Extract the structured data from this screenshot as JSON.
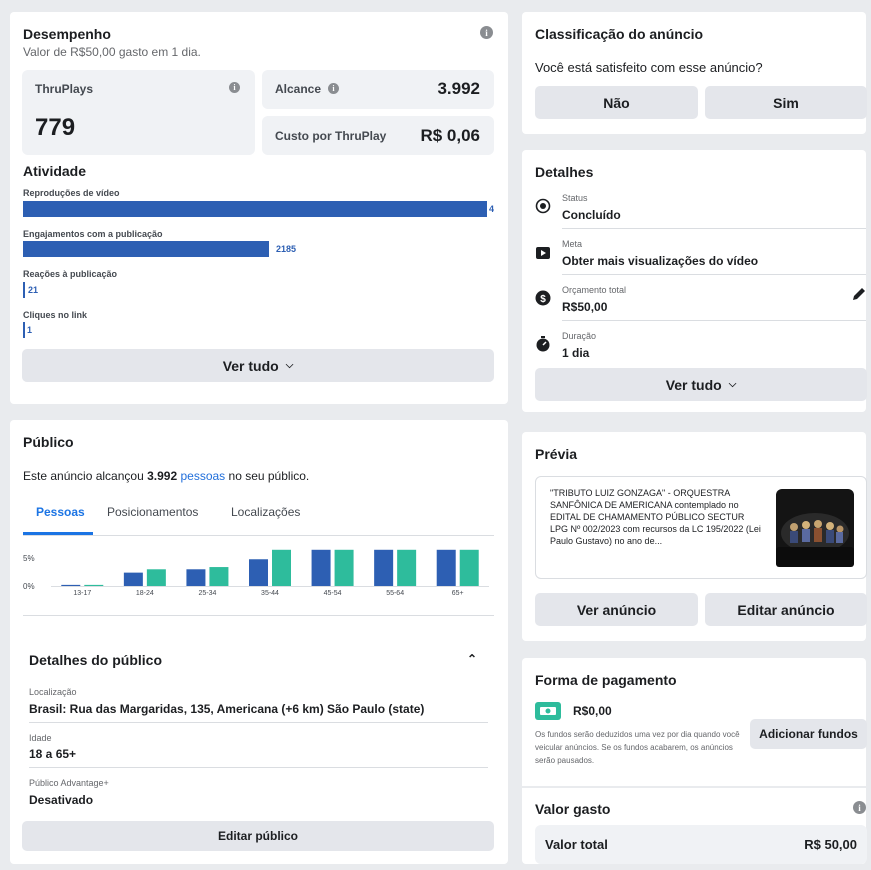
{
  "performance": {
    "title": "Desempenho",
    "subtitle": "Valor de R$50,00 gasto em 1 dia.",
    "thruplays_label": "ThruPlays",
    "thruplays_value": "779",
    "reach_label": "Alcance",
    "reach_value": "3.992",
    "cost_label": "Custo por ThruPlay",
    "cost_value": "R$ 0,06"
  },
  "activity": {
    "title": "Atividade",
    "items": [
      {
        "label": "Reproduções de vídeo",
        "value": "4",
        "fraction": 1.0
      },
      {
        "label": "Engajamentos com a publicação",
        "value": "2185",
        "fraction": 0.53
      },
      {
        "label": "Reações à publicação",
        "value": "21",
        "fraction": 0.005
      },
      {
        "label": "Cliques no link",
        "value": "1",
        "fraction": 0.001
      }
    ],
    "see_all": "Ver tudo"
  },
  "audience": {
    "title": "Público",
    "reach_prefix": "Este anúncio alcançou",
    "reach_number": "3.992",
    "reach_link": "pessoas",
    "reach_suffix": "no seu público.",
    "tabs": [
      "Pessoas",
      "Posicionamentos",
      "Localizações"
    ],
    "details_title": "Detalhes do público",
    "location_label": "Localização",
    "location_value": "Brasil: Rua das Margaridas, 135, Americana (+6 km) São Paulo (state)",
    "age_label": "Idade",
    "age_value": "18 a 65+",
    "advantage_label": "Público Advantage+",
    "advantage_value": "Desativado",
    "edit_button": "Editar público"
  },
  "chart_data": {
    "type": "bar",
    "categories": [
      "13-17",
      "18-24",
      "25-34",
      "35-44",
      "45-54",
      "55-64",
      "65+"
    ],
    "yticks": [
      "5%",
      "0%"
    ],
    "ylim": [
      0,
      7
    ],
    "series": [
      {
        "color": "#2d5fb3",
        "values": [
          0.2,
          2.4,
          3.0,
          4.8,
          6.5,
          6.5,
          6.5
        ]
      },
      {
        "color": "#2ebc9c",
        "values": [
          0.2,
          3.0,
          3.4,
          6.5,
          6.5,
          6.5,
          6.5
        ]
      }
    ]
  },
  "rating": {
    "title": "Classificação do anúncio",
    "question": "Você está satisfeito com esse anúncio?",
    "no_label": "Não",
    "yes_label": "Sim"
  },
  "details": {
    "title": "Detalhes",
    "rows": [
      {
        "label": "Status",
        "value": "Concluído"
      },
      {
        "label": "Meta",
        "value": "Obter mais visualizações do vídeo"
      },
      {
        "label": "Orçamento total",
        "value": "R$50,00"
      },
      {
        "label": "Duração",
        "value": "1 dia"
      }
    ],
    "see_all": "Ver tudo"
  },
  "preview": {
    "title": "Prévia",
    "text": "\"TRIBUTO LUIZ GONZAGA\" - ORQUESTRA SANFÔNICA DE AMERICANA contemplado no EDITAL DE CHAMAMENTO PÚBLICO SECTUR LPG Nº 002/2023 com recursos da LC 195/2022 (Lei Paulo Gustavo) no ano de...",
    "view_button": "Ver anúncio",
    "edit_button": "Editar anúncio"
  },
  "payment": {
    "title": "Forma de pagamento",
    "balance": "R$0,00",
    "note": "Os fundos serão deduzidos uma vez por dia quando você veicular anúncios. Se os fundos acabarem, os anúncios serão pausados.",
    "add_funds": "Adicionar fundos"
  },
  "spent": {
    "title": "Valor gasto",
    "total_label": "Valor total",
    "total_value": "R$ 50,00"
  }
}
